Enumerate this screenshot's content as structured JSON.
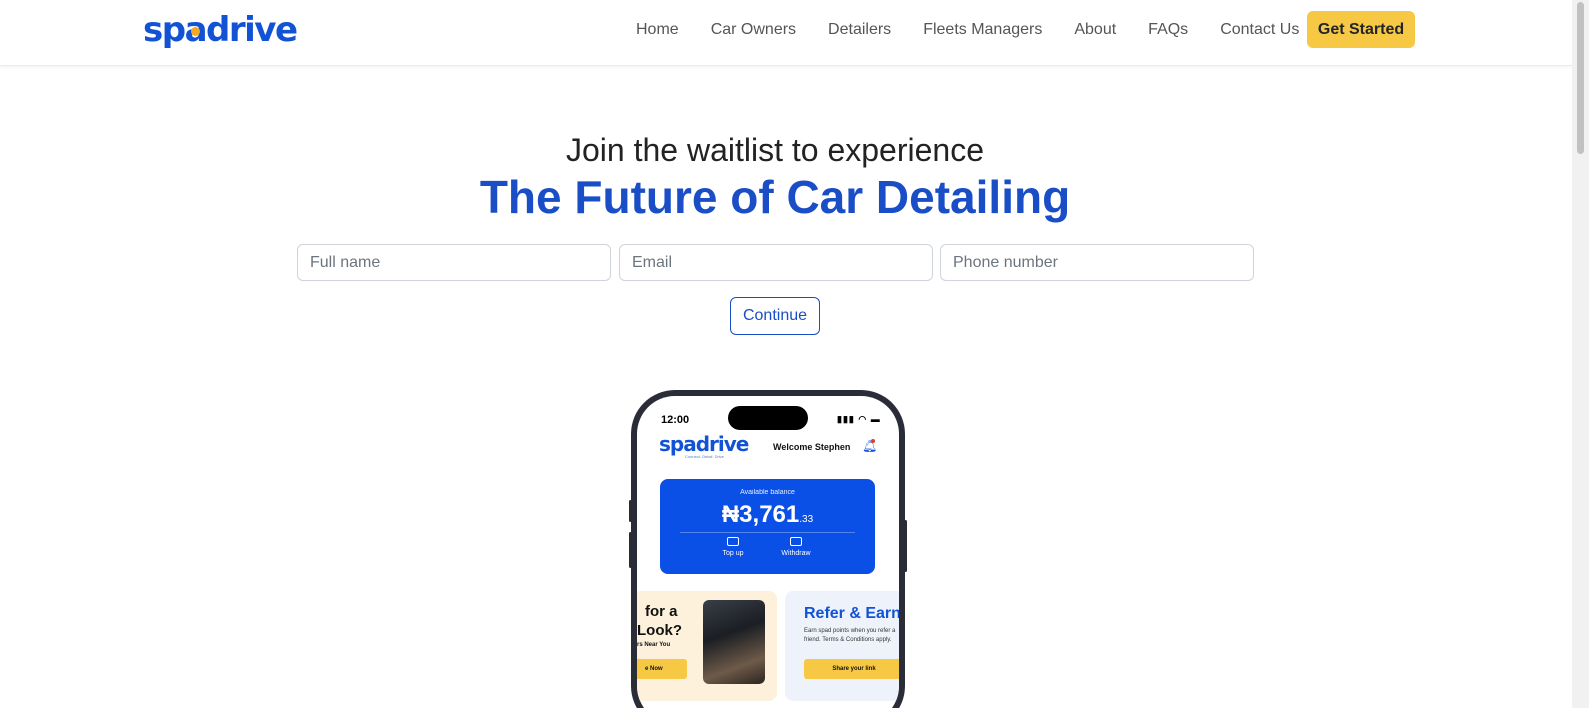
{
  "brand": {
    "logo": "spadrive",
    "accent": "#1a4ec7",
    "cta_color": "#f7c843"
  },
  "nav": {
    "items": [
      "Home",
      "Car Owners",
      "Detailers",
      "Fleets Managers",
      "About",
      "FAQs",
      "Contact Us"
    ],
    "cta": "Get Started"
  },
  "hero": {
    "subtitle": "Join the waitlist to experience",
    "title": "The Future of Car Detailing"
  },
  "form": {
    "full_name_placeholder": "Full name",
    "email_placeholder": "Email",
    "phone_placeholder": "Phone number",
    "submit_label": "Continue"
  },
  "phone": {
    "time": "12:00",
    "status_icons": "▮▮▮ ◠ ▬",
    "app_logo": "spadrive",
    "tagline": "Connect. Detail. Drive",
    "welcome": "Welcome Stephen",
    "balance_label": "Available balance",
    "balance_main": "₦3,761",
    "balance_cents": ".33",
    "actions": [
      "Top up",
      "Withdraw"
    ],
    "promo_left": {
      "line1": "for a",
      "line2": "Look?",
      "line3": "rs Near You",
      "button": "e Now"
    },
    "promo_right": {
      "title": "Refer & Earn",
      "desc": "Earn spad points when you refer a friend. Terms & Conditions apply.",
      "button": "Share your link"
    }
  }
}
